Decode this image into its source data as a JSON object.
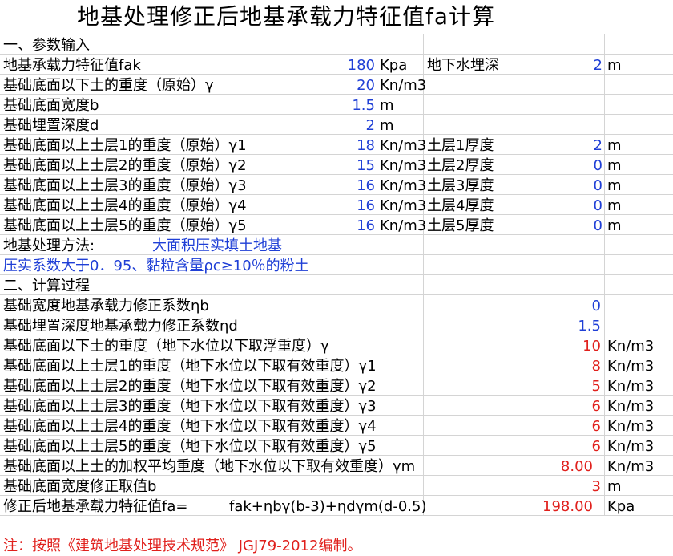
{
  "title": "地基处理修正后地基承载力特征值fa计算",
  "section1": "一、参数输入",
  "section2": "二、计算过程",
  "inputs": [
    {
      "label": "地基承载力特征值fak",
      "value": "180",
      "unit": "Kpa",
      "side_label": "地下水埋深",
      "side_value": "2",
      "side_unit": "m"
    },
    {
      "label": "基础底面以下土的重度（原始）γ",
      "value": "20",
      "unit": "Kn/m3"
    },
    {
      "label": "基础底面宽度b",
      "value": "1.5",
      "unit": "m"
    },
    {
      "label": "基础埋置深度d",
      "value": "2",
      "unit": "m"
    },
    {
      "label": "基础底面以上土层1的重度（原始）γ1",
      "value": "18",
      "unit": "Kn/m3",
      "side_label": "土层1厚度",
      "side_value": "2",
      "side_unit": "m"
    },
    {
      "label": "基础底面以上土层2的重度（原始）γ2",
      "value": "15",
      "unit": "Kn/m3",
      "side_label": "土层2厚度",
      "side_value": "0",
      "side_unit": "m"
    },
    {
      "label": "基础底面以上土层3的重度（原始）γ3",
      "value": "16",
      "unit": "Kn/m3",
      "side_label": "土层3厚度",
      "side_value": "0",
      "side_unit": "m"
    },
    {
      "label": "基础底面以上土层4的重度（原始）γ4",
      "value": "16",
      "unit": "Kn/m3",
      "side_label": "土层4厚度",
      "side_value": "0",
      "side_unit": "m"
    },
    {
      "label": "基础底面以上土层5的重度（原始）γ5",
      "value": "16",
      "unit": "Kn/m3",
      "side_label": "土层5厚度",
      "side_value": "0",
      "side_unit": "m"
    }
  ],
  "method_label": "地基处理方法:",
  "method_value": "大面积压实填土地基",
  "method_detail": "压实系数大于0．95、黏粒含量ρc≥10％的粉土",
  "calc": [
    {
      "label": "基础宽度地基承载力修正系数ηb",
      "value": "0",
      "unit": "",
      "color": "blue"
    },
    {
      "label": "基础埋置深度地基承载力修正系数ηd",
      "value": "1.5",
      "unit": "",
      "color": "blue"
    },
    {
      "label": "基础底面以下土的重度（地下水位以下取浮重度）γ",
      "value": "10",
      "unit": "Kn/m3",
      "color": "red"
    },
    {
      "label": "基础底面以上土层1的重度（地下水位以下取有效重度）γ1",
      "value": "8",
      "unit": "Kn/m3",
      "color": "red"
    },
    {
      "label": "基础底面以上土层2的重度（地下水位以下取有效重度）γ2",
      "value": "5",
      "unit": "Kn/m3",
      "color": "red"
    },
    {
      "label": "基础底面以上土层3的重度（地下水位以下取有效重度）γ3",
      "value": "6",
      "unit": "Kn/m3",
      "color": "red"
    },
    {
      "label": "基础底面以上土层4的重度（地下水位以下取有效重度）γ4",
      "value": "6",
      "unit": "Kn/m3",
      "color": "red"
    },
    {
      "label": "基础底面以上土层5的重度（地下水位以下取有效重度）γ5",
      "value": "6",
      "unit": "Kn/m3",
      "color": "red"
    },
    {
      "label": "基础底面以上土的加权平均重度（地下水位以下取有效重度）γm",
      "value": "8.00",
      "unit": "Kn/m3",
      "color": "red"
    },
    {
      "label": "基础底面宽度修正取值b",
      "value": "3",
      "unit": "m",
      "color": "red"
    }
  ],
  "final": {
    "label": "修正后地基承载力特征值fa=",
    "formula": "fak+ηbγ(b-3)+ηdγm(d-0.5)",
    "value": "198.00",
    "unit": "Kpa"
  },
  "note": "注：按照《建筑地基处理技术规范》 JGJ79-2012编制。",
  "colors": {
    "input_blue": "#1f3fd6",
    "result_red": "#e0201c",
    "grid": "#d4d4d4"
  }
}
